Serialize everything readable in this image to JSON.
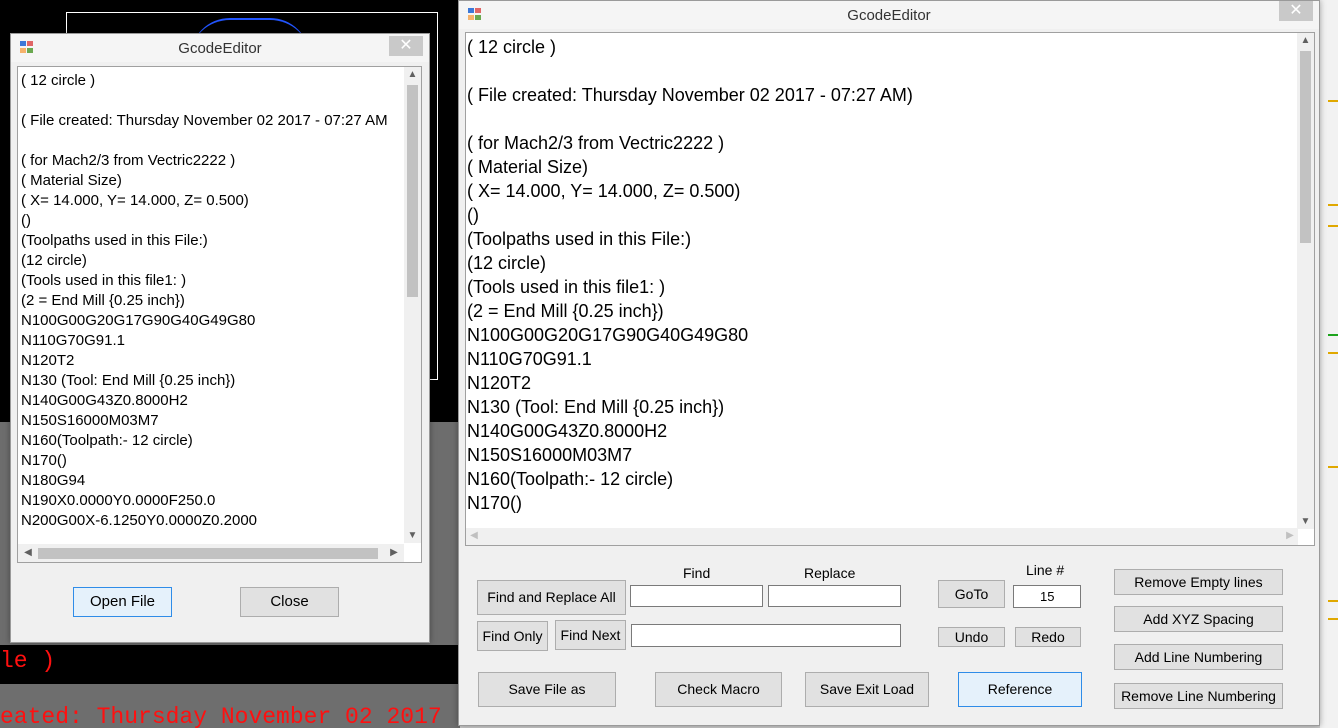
{
  "background": {
    "red_text_1": "le )",
    "red_text_2": "eated: Thursday November 02 2017"
  },
  "small_window": {
    "title": "GcodeEditor",
    "close_glyph": "✕",
    "lines": [
      "( 12 circle )",
      "",
      "( File created: Thursday November 02 2017 - 07:27 AM",
      "",
      "( for Mach2/3 from Vectric2222 )",
      "( Material Size)",
      "( X= 14.000, Y= 14.000, Z= 0.500)",
      "()",
      "(Toolpaths used in this File:)",
      "(12 circle)",
      "(Tools used in this file1: )",
      "(2 = End Mill {0.25 inch})",
      "N100G00G20G17G90G40G49G80",
      "N110G70G91.1",
      "N120T2",
      "N130 (Tool: End Mill {0.25 inch})",
      "N140G00G43Z0.8000H2",
      "N150S16000M03M7",
      "N160(Toolpath:- 12 circle)",
      "N170()",
      "N180G94",
      "N190X0.0000Y0.0000F250.0",
      "N200G00X-6.1250Y0.0000Z0.2000"
    ],
    "open_file_label": "Open File",
    "close_label": "Close"
  },
  "main_window": {
    "title": "GcodeEditor",
    "close_glyph": "✕",
    "lines": [
      "( 12 circle )",
      "",
      "( File created: Thursday November 02 2017 - 07:27 AM)",
      "",
      "( for Mach2/3 from Vectric2222 )",
      "( Material Size)",
      "( X= 14.000, Y= 14.000, Z= 0.500)",
      "()",
      "(Toolpaths used in this File:)",
      "(12 circle)",
      "(Tools used in this file1: )",
      "(2 = End Mill {0.25 inch})",
      "N100G00G20G17G90G40G49G80",
      "N110G70G91.1",
      "N120T2",
      "N130 (Tool: End Mill {0.25 inch})",
      "N140G00G43Z0.8000H2",
      "N150S16000M03M7",
      "N160(Toolpath:- 12 circle)",
      "N170()"
    ],
    "find_label": "Find",
    "replace_label": "Replace",
    "line_label": "Line #",
    "find_value": "",
    "replace_value": "",
    "find_next_value": "",
    "line_value": "15",
    "buttons": {
      "find_replace_all": "Find and Replace All",
      "find_only": "Find Only",
      "find_next": "Find Next",
      "goto": "GoTo",
      "undo": "Undo",
      "redo": "Redo",
      "remove_empty_lines": "Remove Empty lines",
      "add_xyz_spacing": "Add XYZ Spacing",
      "add_line_numbering": "Add Line Numbering",
      "remove_line_numbering": "Remove Line Numbering",
      "save_file_as": "Save File as",
      "check_macro": "Check Macro",
      "save_exit_load": "Save Exit Load",
      "reference": "Reference"
    }
  }
}
